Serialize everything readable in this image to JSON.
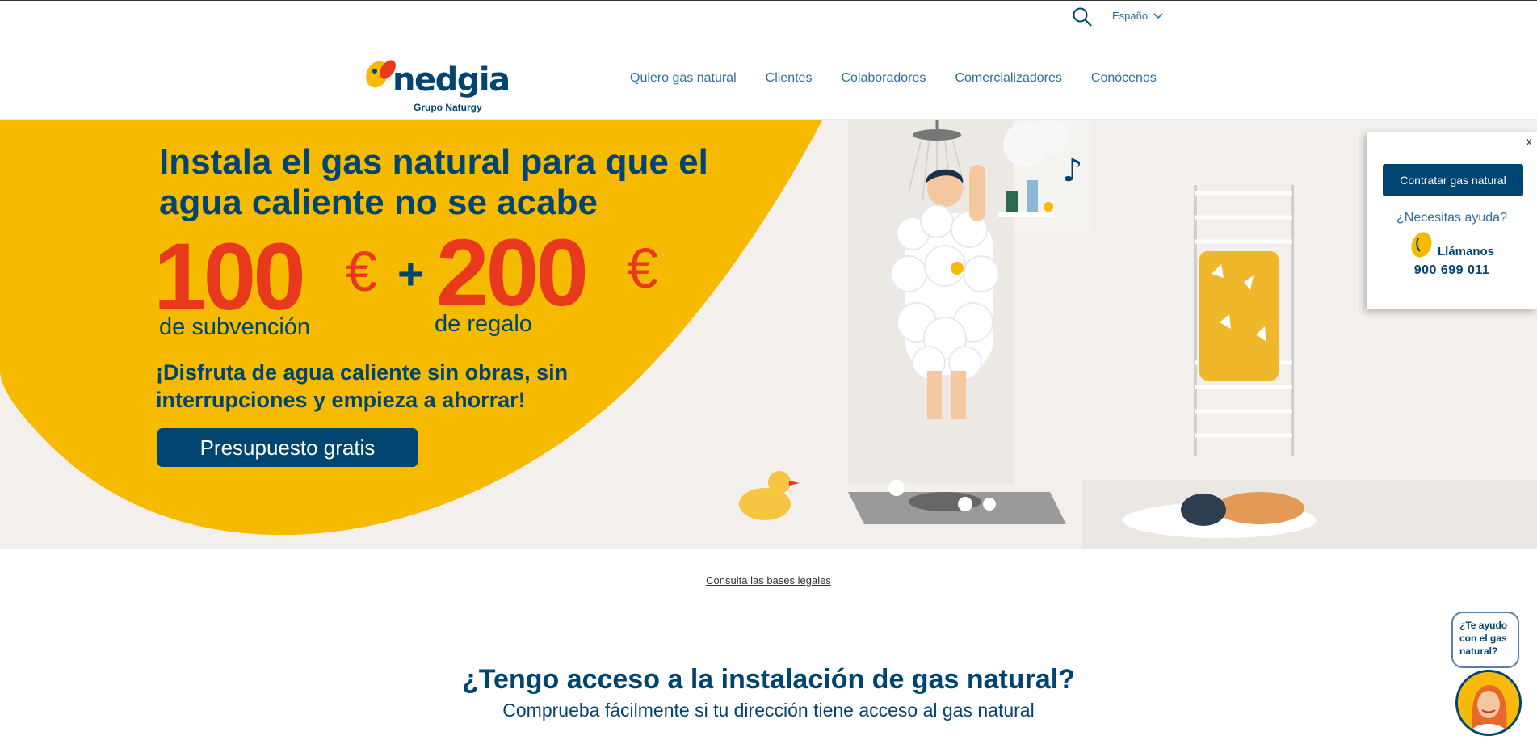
{
  "header": {
    "language": "Español",
    "logo_text": "nedgia",
    "logo_tagline": "Grupo Naturgy",
    "nav": [
      "Quiero gas natural",
      "Clientes",
      "Colaboradores",
      "Comercializadores",
      "Conócenos"
    ]
  },
  "hero": {
    "title": "Instala el gas natural para que el agua caliente no se acabe",
    "amount1": "100",
    "amount2": "200",
    "currency": "€",
    "plus": "+",
    "amount1_label": "de subvención",
    "amount2_label": "de regalo",
    "text": "¡Disfruta de agua caliente sin obras, sin interrupciones y empieza a ahorrar!",
    "cta": "Presupuesto gratis"
  },
  "help_panel": {
    "close": "x",
    "button": "Contratar gas natural",
    "question": "¿Necesitas ayuda?",
    "call_label": "Llámanos",
    "phone": "900 699 011"
  },
  "legal_link": "Consulta las bases legales",
  "section": {
    "title": "¿Tengo acceso a la instalación de gas natural?",
    "subtitle": "Comprueba fácilmente si tu dirección tiene acceso al gas natural"
  },
  "chat": {
    "bubble": "¿Te ayudo con el gas natural?"
  },
  "colors": {
    "brand_blue": "#004571",
    "link_blue": "#2c6e9e",
    "yellow": "#f6ba00",
    "red": "#e8391d"
  }
}
